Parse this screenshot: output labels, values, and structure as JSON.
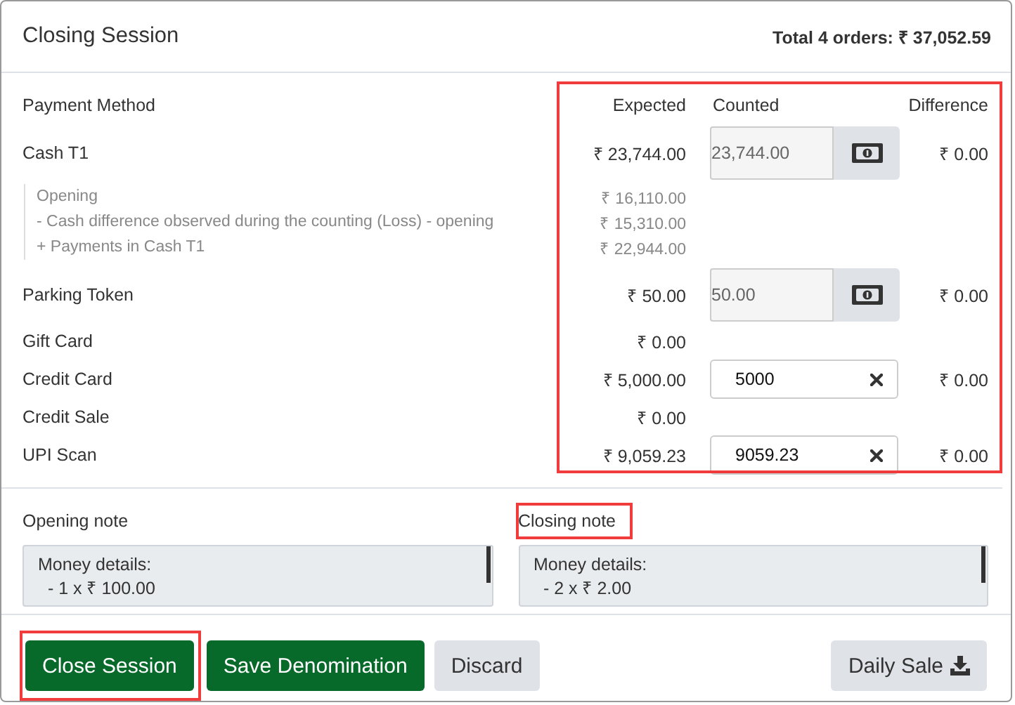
{
  "dialog": {
    "title": "Closing Session",
    "total": "Total 4 orders: ₹ 37,052.59"
  },
  "table": {
    "highlighted": true,
    "columns": [
      "Payment Method",
      "Expected",
      "Counted",
      "Difference"
    ],
    "rows": [
      {
        "kind": "cash",
        "method": "Cash T1",
        "expected": "₹ 23,744.00",
        "counted": "23,744.00",
        "difference": "₹ 0.00",
        "details": [
          {
            "label": "Opening",
            "amount": "₹ 16,110.00"
          },
          {
            "label": "- Cash difference observed during the counting (Loss) - opening",
            "amount": "₹ 15,310.00"
          },
          {
            "label": "+ Payments in Cash T1",
            "amount": "₹ 22,944.00"
          }
        ]
      },
      {
        "kind": "cash",
        "method": "Parking Token",
        "expected": "₹ 50.00",
        "counted": "50.00",
        "difference": "₹ 0.00"
      },
      {
        "kind": "plain",
        "method": "Gift Card",
        "expected": "₹ 0.00"
      },
      {
        "kind": "input",
        "method": "Credit Card",
        "expected": "₹ 5,000.00",
        "counted": "5000",
        "difference": "₹ 0.00"
      },
      {
        "kind": "plain",
        "method": "Credit Sale",
        "expected": "₹ 0.00"
      },
      {
        "kind": "input",
        "method": "UPI Scan",
        "expected": "₹ 9,059.23",
        "counted": "9059.23",
        "difference": "₹ 0.00"
      }
    ]
  },
  "notes": [
    {
      "label": "Opening note",
      "highlighted": false,
      "lines": [
        "Money details:",
        "  - 1 x ₹ 100.00"
      ]
    },
    {
      "label": "Closing note",
      "highlighted": true,
      "lines": [
        "Money details:",
        "  - 2 x ₹ 2.00"
      ]
    }
  ],
  "buttons": [
    {
      "label": "Close Session",
      "kind": "primary",
      "highlighted": true,
      "icon": false
    },
    {
      "label": "Save Denomination",
      "kind": "primary",
      "highlighted": false,
      "icon": false
    },
    {
      "label": "Discard",
      "kind": "secondary",
      "highlighted": false,
      "icon": false
    },
    {
      "label": "Daily Sale",
      "kind": "secondary",
      "highlighted": false,
      "icon": true
    }
  ]
}
